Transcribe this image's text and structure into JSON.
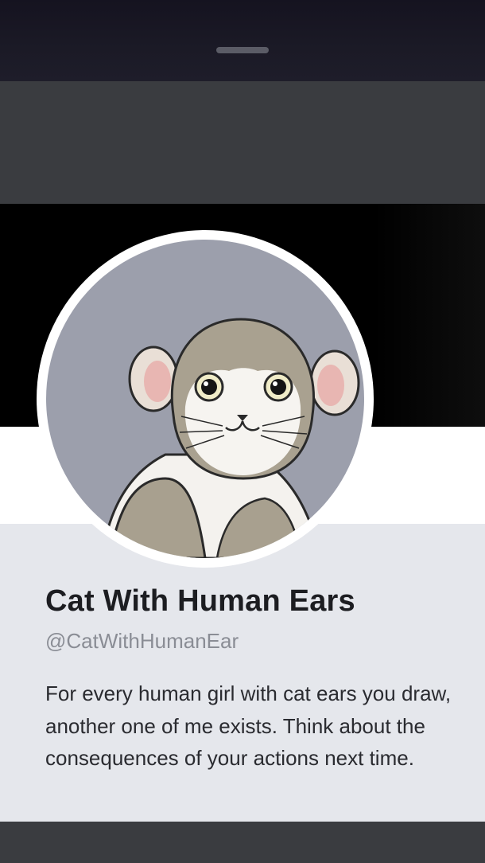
{
  "profile": {
    "display_name": "Cat With Human Ears",
    "username": "@CatWithHumanEar",
    "bio": "For every human girl with cat ears you draw, another one of me exists. Think about the consequences of your actions next time."
  },
  "colors": {
    "page_background": "#3a3c40",
    "card_background": "#e5e7ec",
    "name_text": "#1c1d21",
    "username_text": "#8a8d95"
  }
}
